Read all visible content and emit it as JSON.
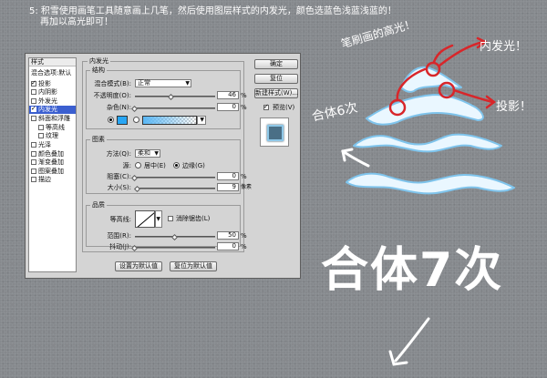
{
  "instructions": {
    "line1": "5:  积雪使用画笔工具随意画上几笔，然后使用图层样式的内发光，颜色选蓝色浅蓝浅蓝的！",
    "line2": "再加以高光即可！"
  },
  "styles_list": {
    "items": [
      {
        "label": "样式",
        "checkbox": false,
        "checked": false,
        "selected": false,
        "indent": false,
        "head": true
      },
      {
        "label": "混合选项:默认",
        "checkbox": false,
        "checked": false,
        "selected": false,
        "indent": false,
        "head": false
      },
      {
        "label": "投影",
        "checkbox": true,
        "checked": true,
        "selected": false,
        "indent": false,
        "head": false
      },
      {
        "label": "内阴影",
        "checkbox": true,
        "checked": false,
        "selected": false,
        "indent": false,
        "head": false
      },
      {
        "label": "外发光",
        "checkbox": true,
        "checked": false,
        "selected": false,
        "indent": false,
        "head": false
      },
      {
        "label": "内发光",
        "checkbox": true,
        "checked": true,
        "selected": true,
        "indent": false,
        "head": false
      },
      {
        "label": "斜面和浮雕",
        "checkbox": true,
        "checked": false,
        "selected": false,
        "indent": false,
        "head": false
      },
      {
        "label": "等高线",
        "checkbox": true,
        "checked": false,
        "selected": false,
        "indent": true,
        "head": false
      },
      {
        "label": "纹理",
        "checkbox": true,
        "checked": false,
        "selected": false,
        "indent": true,
        "head": false
      },
      {
        "label": "光泽",
        "checkbox": true,
        "checked": false,
        "selected": false,
        "indent": false,
        "head": false
      },
      {
        "label": "颜色叠加",
        "checkbox": true,
        "checked": false,
        "selected": false,
        "indent": false,
        "head": false
      },
      {
        "label": "渐变叠加",
        "checkbox": true,
        "checked": false,
        "selected": false,
        "indent": false,
        "head": false
      },
      {
        "label": "图案叠加",
        "checkbox": true,
        "checked": false,
        "selected": false,
        "indent": false,
        "head": false
      },
      {
        "label": "描边",
        "checkbox": true,
        "checked": false,
        "selected": false,
        "indent": false,
        "head": false
      }
    ]
  },
  "inner_glow": {
    "title": "内发光",
    "structure": {
      "title": "结构",
      "blend_mode_label": "混合模式(B):",
      "blend_mode_value": "正常",
      "opacity_label": "不透明度(O):",
      "opacity_value": "46",
      "opacity_fraction": 0.46,
      "noise_label": "杂色(N):",
      "noise_value": "0",
      "noise_fraction": 0,
      "percent": "%",
      "color_hex": "#29a6f4"
    },
    "elements": {
      "title": "图素",
      "method_label": "方法(Q):",
      "method_value": "柔和",
      "source_label": "源:",
      "center_label": "居中(E)",
      "edge_label": "边缘(G)",
      "choke_label": "阻塞(C):",
      "choke_value": "0",
      "choke_fraction": 0,
      "size_label": "大小(S):",
      "size_value": "9",
      "size_fraction": 0.036,
      "percent": "%",
      "pixels": "像素"
    },
    "quality": {
      "title": "品质",
      "contour_label": "等高线:",
      "antialias_label": "消除锯齿(L)",
      "range_label": "范围(R):",
      "range_value": "50",
      "range_fraction": 0.5,
      "jitter_label": "抖动(J):",
      "jitter_value": "0",
      "jitter_fraction": 0,
      "percent": "%"
    },
    "make_default": "设置为默认值",
    "reset_default": "复位为默认值"
  },
  "buttons": {
    "ok": "确定",
    "reset": "复位",
    "new_style": "新建样式(W)...",
    "preview_label": "预览(V)"
  },
  "annotations": {
    "highlight": "笔刷画的高光！",
    "inner_glow": "内发光！",
    "shadow": "投影！",
    "merge6": "合体6次",
    "merge7": "合体7次"
  },
  "colors": {
    "background": "#86898d",
    "selected_item": "#3b5fd0",
    "glow_color": "#29a6f4",
    "red_mark": "#d8262a",
    "snow_blue": "#9fd3f1"
  }
}
